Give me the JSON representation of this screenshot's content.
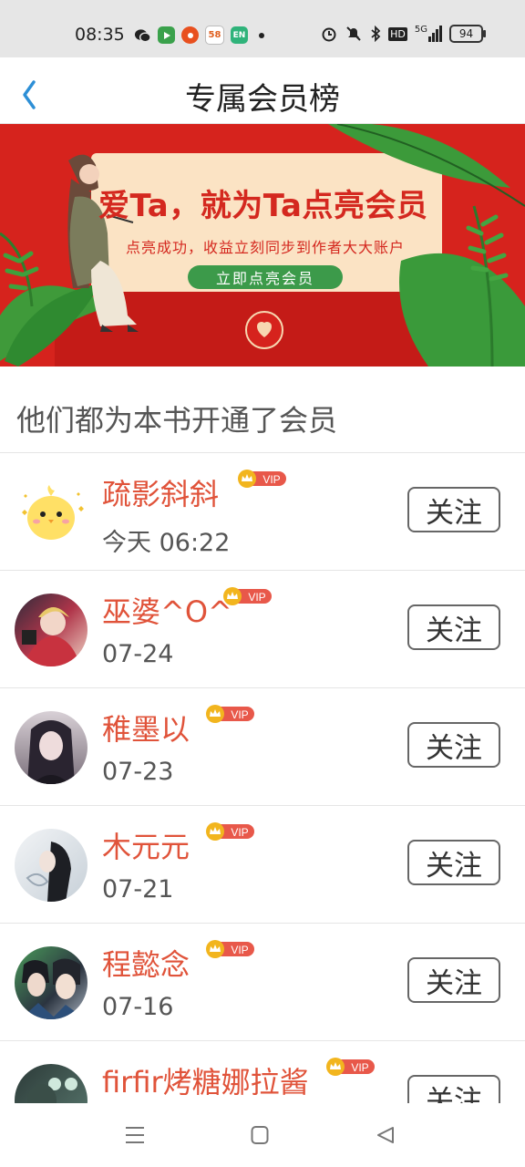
{
  "status_bar": {
    "time": "08:35",
    "app_icons": [
      "wechat-icon",
      "video-app-icon",
      "taobao-icon",
      "58-app-icon",
      "en-app-icon"
    ],
    "app_58_label": "58",
    "app_en_label": "EN",
    "indicators": [
      "alarm-icon",
      "mute-icon",
      "bluetooth-icon",
      "hd-icon",
      "5g-signal-icon"
    ],
    "hd_label": "HD",
    "network_label": "5G",
    "battery": "94"
  },
  "header": {
    "back_icon": "chevron-left-icon",
    "title": "专属会员榜"
  },
  "banner": {
    "headline": "爱Ta，就为Ta点亮会员",
    "subline": "点亮成功，收益立刻同步到作者大大账户",
    "cta": "立即点亮会员",
    "colors": {
      "background": "#d6231d",
      "card": "#fbe3c4",
      "cta_bg": "#3c9a4a",
      "headline": "#d4281f"
    }
  },
  "section": {
    "title": "他们都为本书开通了会员"
  },
  "members": [
    {
      "name": "疏影斜斜",
      "date": "今天 06:22",
      "badge": "VIP",
      "button": "关注",
      "avatar": "chick-avatar"
    },
    {
      "name": "巫婆^O^",
      "date": "07-24",
      "badge": "VIP",
      "button": "关注",
      "avatar": "photo-avatar"
    },
    {
      "name": "稚墨以",
      "date": "07-23",
      "badge": "VIP",
      "button": "关注",
      "avatar": "photo-avatar"
    },
    {
      "name": "木元元",
      "date": "07-21",
      "badge": "VIP",
      "button": "关注",
      "avatar": "photo-avatar"
    },
    {
      "name": "程懿念",
      "date": "07-16",
      "badge": "VIP",
      "button": "关注",
      "avatar": "photo-avatar"
    },
    {
      "name": "firfir烤糖娜拉酱",
      "date": "",
      "badge": "VIP",
      "button": "关注",
      "avatar": "photo-avatar"
    }
  ],
  "colors": {
    "accent_blue": "#2d8fd6",
    "name_red": "#e0533a",
    "vip_badge": "#e8584a",
    "crown_gold": "#f2b51e"
  },
  "nav_bar": {
    "buttons": [
      "menu-icon",
      "home-icon",
      "back-triangle-icon"
    ]
  }
}
